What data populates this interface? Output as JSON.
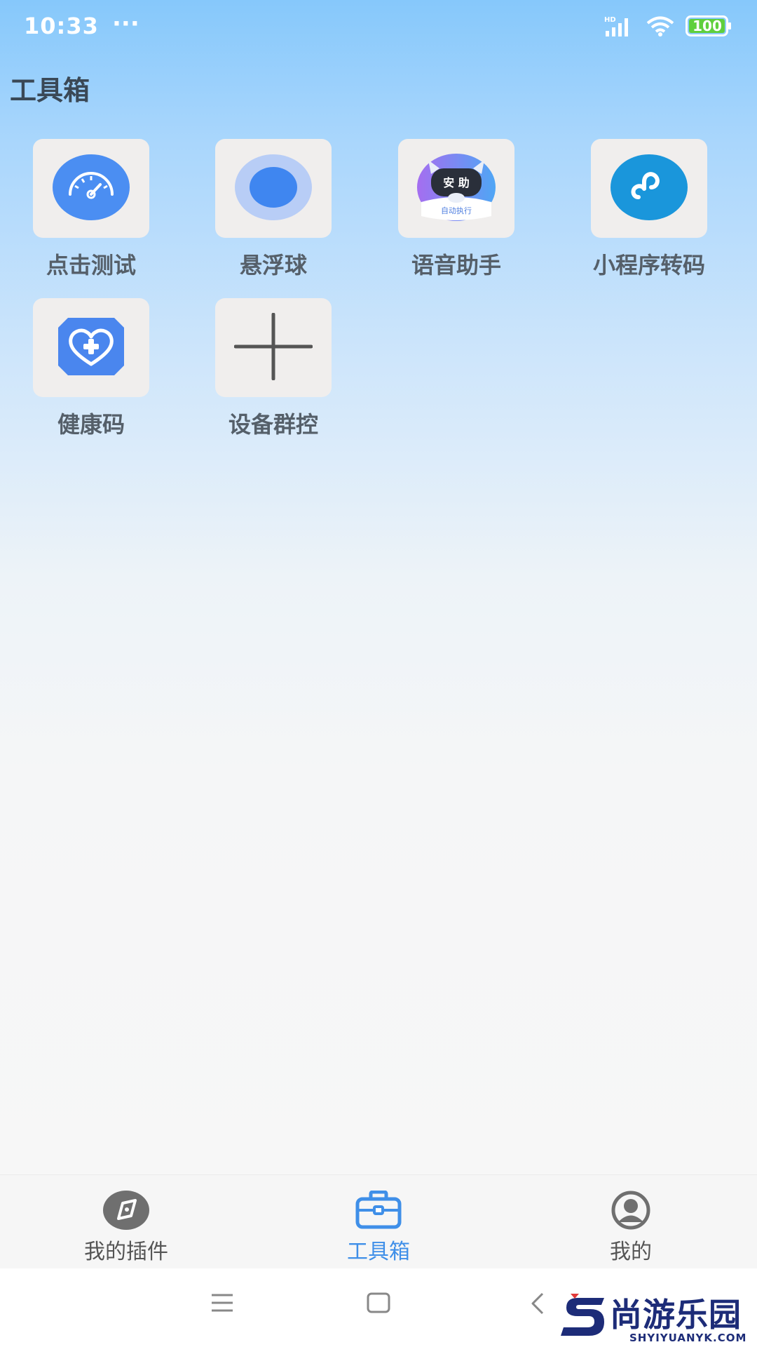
{
  "status_bar": {
    "time": "10:33",
    "more": "···",
    "network_badge": "HD",
    "battery": "100"
  },
  "page": {
    "title": "工具箱"
  },
  "tools": [
    {
      "label": "点击测试",
      "icon": "speedometer-icon"
    },
    {
      "label": "悬浮球",
      "icon": "floating-ball-icon"
    },
    {
      "label": "语音助手",
      "icon": "voice-assistant-icon",
      "badge_top": "安 助",
      "badge_bottom": "自动执行"
    },
    {
      "label": "小程序转码",
      "icon": "mini-program-icon"
    },
    {
      "label": "健康码",
      "icon": "health-heart-icon"
    },
    {
      "label": "设备群控",
      "icon": "plus-icon"
    }
  ],
  "bottom_nav": {
    "items": [
      {
        "label": "我的插件",
        "icon": "compass-icon",
        "active": false
      },
      {
        "label": "工具箱",
        "icon": "toolbox-icon",
        "active": true
      },
      {
        "label": "我的",
        "icon": "user-profile-icon",
        "active": false
      }
    ]
  },
  "system_nav": {
    "buttons": [
      "menu-icon",
      "home-icon",
      "back-icon"
    ]
  },
  "watermark": {
    "text": "尚游乐园",
    "sub": "SHYIYUANYK.COM"
  },
  "colors": {
    "accent": "#3f8fe8",
    "tile_bg": "#f0eeed",
    "title": "#3a4856"
  }
}
